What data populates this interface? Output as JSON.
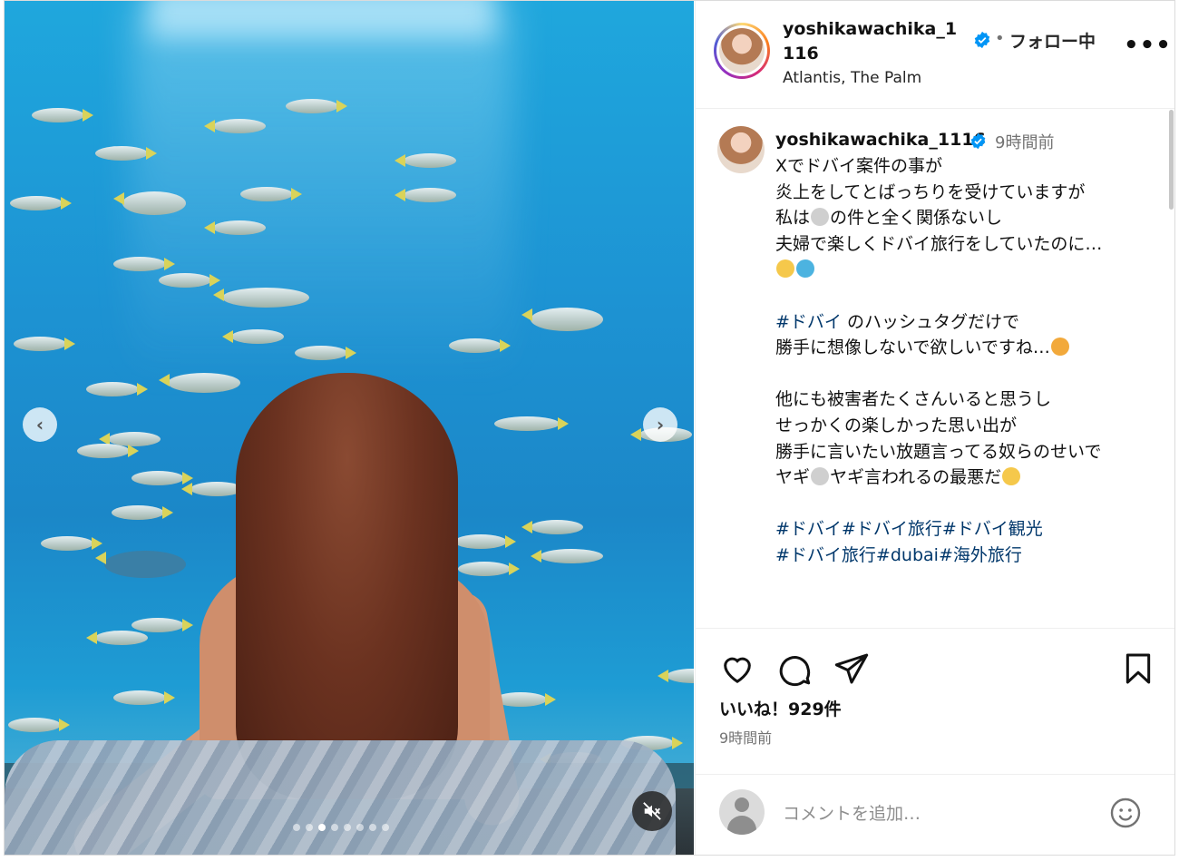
{
  "post": {
    "username": "yoshikawachika_1116",
    "separator": "•",
    "follow_label": "フォロー中",
    "more_label": "•••",
    "location": "Atlantis, The Palm"
  },
  "media": {
    "prev_glyph": "‹",
    "next_glyph": "›",
    "carousel_count": 8,
    "carousel_active_index": 2
  },
  "caption": {
    "username": "yoshikawachika_1116",
    "time": "9時間前",
    "lines": [
      "Xでドバイ案件の事が",
      "炎上をしてとばっちりを受けていますが",
      "私は",
      "の件と全く関係ないし",
      "夫婦で楽しくドバイ旅行をしていたのに…",
      "のハッシュタグだけで",
      "勝手に想像しないで欲しいですね…",
      "他にも被害者たくさんいると思うし",
      "せっかくの楽しかった思い出が",
      "勝手に言いたい放題言ってる奴らのせいで",
      "ヤギ",
      "ヤギ言われるの最悪だ"
    ],
    "tags_line1": [
      "#ドバイ",
      "#ドバイ旅行",
      "#ドバイ観光"
    ],
    "tags_line2": [
      "#ドバイ旅行",
      "#dubai",
      "#海外旅行"
    ],
    "inline_tag": "#ドバイ"
  },
  "actions": {
    "likes": "いいね！929件",
    "posted_time": "9時間前"
  },
  "comment": {
    "placeholder": "コメントを追加…"
  },
  "icons": [
    "heart-icon",
    "comment-icon",
    "share-icon",
    "bookmark-icon",
    "verified-icon",
    "mute-icon",
    "emoji-icon"
  ],
  "colors": {
    "verified": "#0095f6",
    "hashtag": "#00376b",
    "secondary_text": "#737373"
  }
}
